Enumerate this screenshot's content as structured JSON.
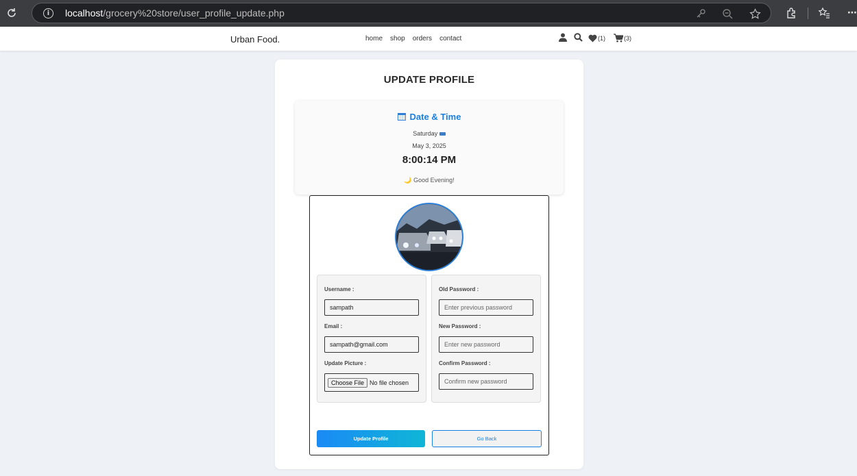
{
  "browser": {
    "url_host": "localhost",
    "url_path": "/grocery%20store/user_profile_update.php"
  },
  "header": {
    "logo": "Urban Food.",
    "nav": [
      "home",
      "shop",
      "orders",
      "contact"
    ],
    "wishlist_count": "(1)",
    "cart_count": "(3)"
  },
  "page": {
    "title": "UPDATE PROFILE",
    "datetime": {
      "heading": "Date & Time",
      "day": "Saturday",
      "date": "May 3, 2025",
      "time": "8:00:14 PM",
      "greeting": "Good Evening!"
    },
    "form": {
      "username_label": "Username :",
      "username_value": "sampath",
      "email_label": "Email :",
      "email_value": "sampath@gmail.com",
      "picture_label": "Update Picture :",
      "file_button": "Choose File",
      "file_status": "No file chosen",
      "old_password_label": "Old Password :",
      "old_password_placeholder": "Enter previous password",
      "new_password_label": "New Password :",
      "new_password_placeholder": "Enter new password",
      "confirm_password_label": "Confirm Password :",
      "confirm_password_placeholder": "Confirm new password",
      "update_button": "Update Profile",
      "back_button": "Go Back"
    }
  },
  "colors": {
    "accent": "#1a7fe0",
    "background": "#eef1f6",
    "chrome": "#3b3d41"
  }
}
